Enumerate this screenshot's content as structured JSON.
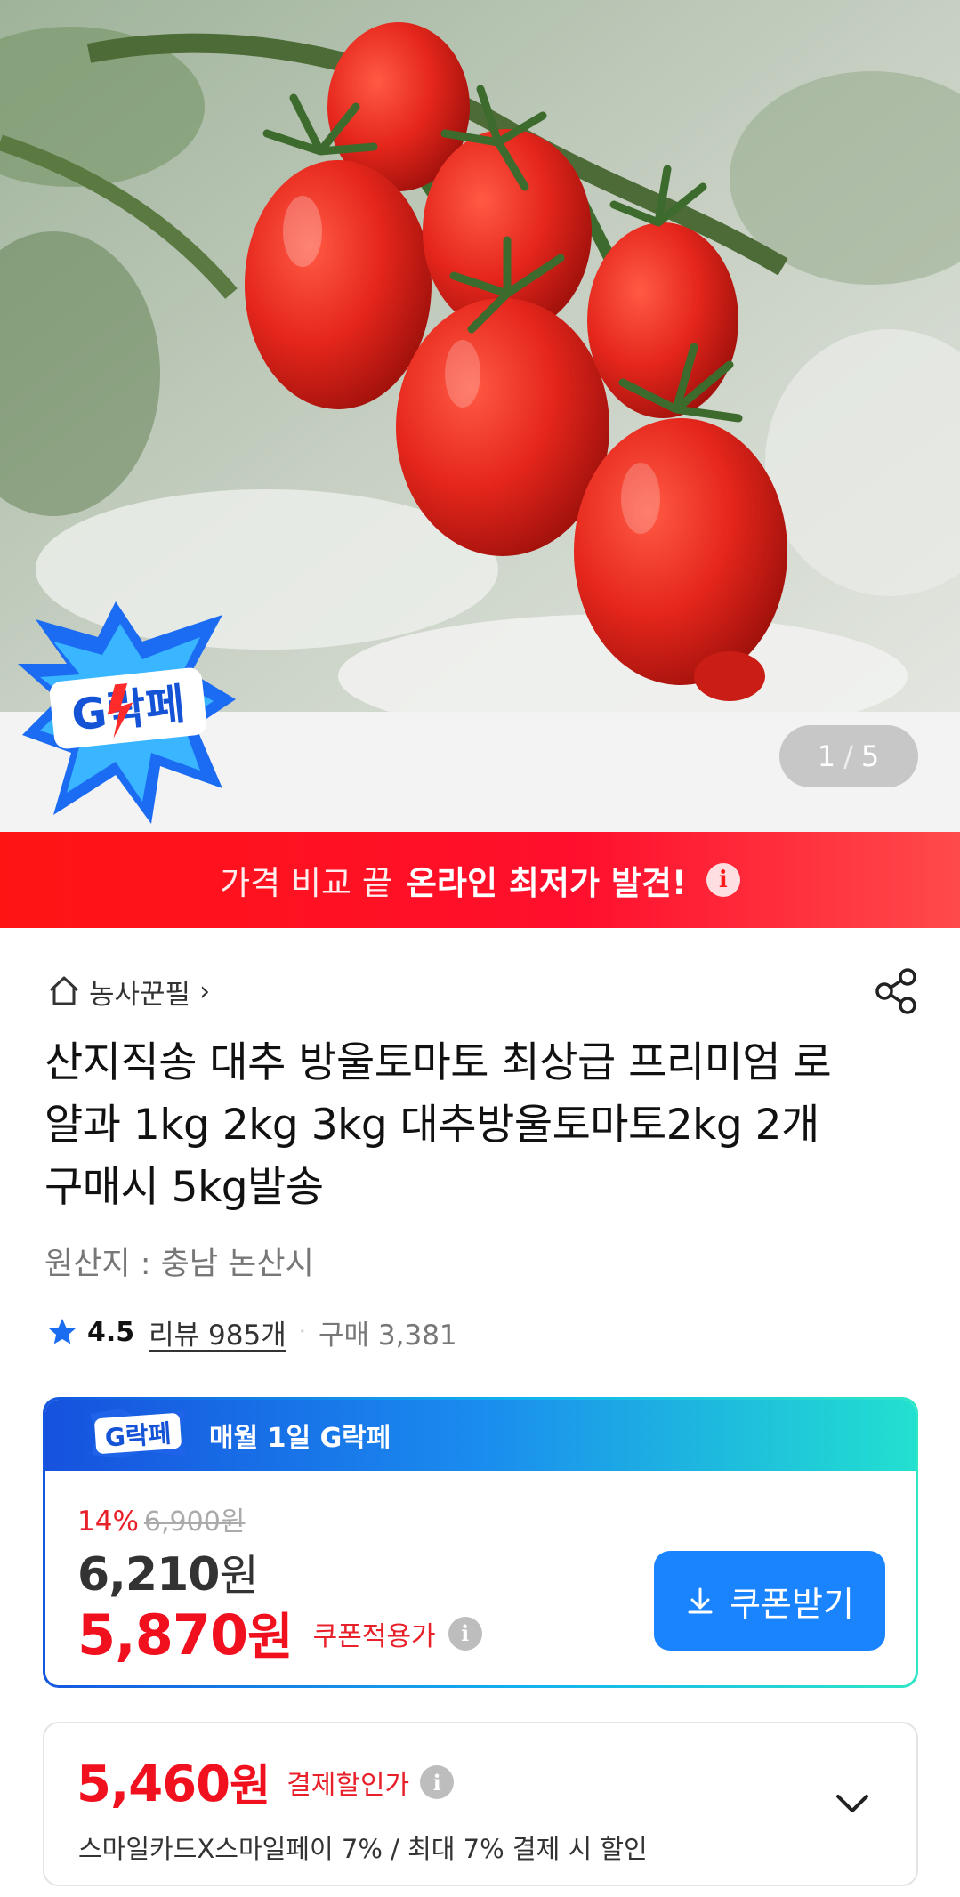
{
  "hero": {
    "page_current": "1",
    "page_separator": "/",
    "page_total": "5",
    "badge_text": "G락페",
    "colors": {
      "tomato": "#e5261c",
      "leaf": "#3d6b2e"
    }
  },
  "promo_banner": {
    "light_text": "가격 비교 끝",
    "bold_text": "온라인 최저가 발견!",
    "info_glyph": "i",
    "color": "#ff1414"
  },
  "store": {
    "name": "농사꾼필",
    "chevron": "›",
    "home_icon": "home-icon",
    "share_icon": "share-icon"
  },
  "product": {
    "title": "산지직송 대추 방울토마토 최상급 프리미엄 로얄과 1kg 2kg 3kg 대추방울토마토2kg 2개 구매시 5kg발송",
    "origin": "원산지 : 충남 논산시"
  },
  "rating": {
    "score": "4.5",
    "reviews": "리뷰 985개",
    "dot": "·",
    "purchases": "구매 3,381"
  },
  "deal": {
    "logo_text": "G락페",
    "header": "매월 1일 G락페",
    "discount_pct": "14%",
    "original_price": "6,900원",
    "sale_price": "6,210",
    "sale_unit": "원",
    "coupon_price": "5,870",
    "coupon_unit": "원",
    "coupon_label": "쿠폰적용가",
    "coupon_button": "쿠폰받기",
    "info_glyph": "i",
    "colors": {
      "accent_blue": "#1a84ff",
      "price_red": "#f0101e"
    }
  },
  "payment": {
    "price": "5,460",
    "unit": "원",
    "label": "결제할인가",
    "info_glyph": "i",
    "description": "스마일카드X스마일페이 7% / 최대 7% 결제 시 할인"
  }
}
